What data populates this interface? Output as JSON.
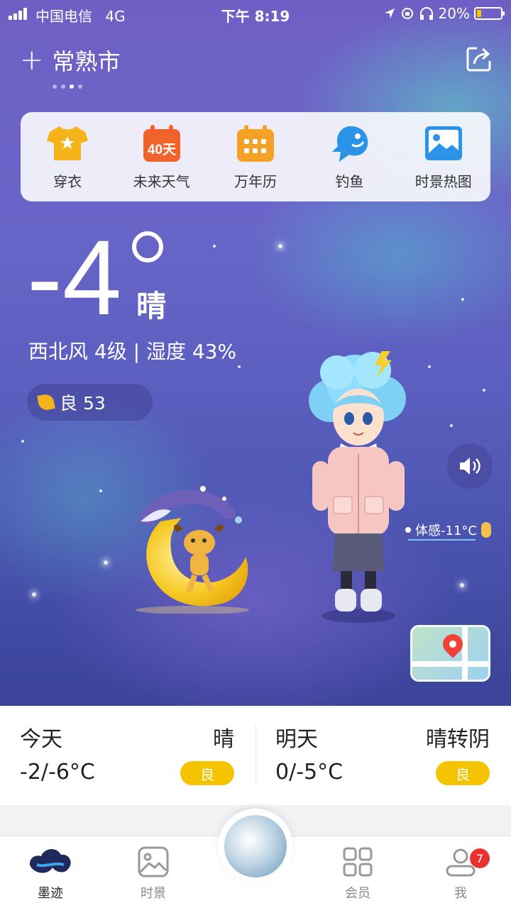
{
  "status_bar": {
    "carrier": "中国电信",
    "network": "4G",
    "time": "下午 8:19",
    "battery_percent": "20%",
    "battery_level": 0.2
  },
  "header": {
    "city": "常熟市",
    "add_icon": "plus-icon",
    "share_icon": "share-icon",
    "page_dots_count": 4,
    "active_page_index": 2
  },
  "shortcuts": [
    {
      "label": "穿衣",
      "icon": "shirt-icon",
      "color": "#f3b319"
    },
    {
      "label": "未来天气",
      "icon": "calendar-40-icon",
      "icon_text": "40天",
      "color": "#f0632a"
    },
    {
      "label": "万年历",
      "icon": "calendar-grid-icon",
      "color": "#f3a226"
    },
    {
      "label": "钓鱼",
      "icon": "fish-icon",
      "color": "#2b93e8"
    },
    {
      "label": "时景热图",
      "icon": "picture-icon",
      "color": "#2b93e8"
    }
  ],
  "current": {
    "temperature": "-4",
    "condition": "晴",
    "wind_humidity": "西北风 4级 | 湿度 43%",
    "aqi_label": "良 53",
    "feels_like": "体感-11°C"
  },
  "forecast": [
    {
      "day": "今天",
      "condition": "晴",
      "range": "-2/-6°C",
      "aqi": "良"
    },
    {
      "day": "明天",
      "condition": "晴转阴",
      "range": "0/-5°C",
      "aqi": "良"
    }
  ],
  "tabs": [
    {
      "label": "墨迹",
      "icon": "moji-cloud-icon",
      "active": true
    },
    {
      "label": "时景",
      "icon": "picture-icon",
      "active": false
    },
    {
      "label": "会员",
      "icon": "grid-icon",
      "active": false
    },
    {
      "label": "我",
      "icon": "profile-icon",
      "active": false
    }
  ],
  "me_badge": "7",
  "colors": {
    "accent_yellow": "#f5c400",
    "badge_red": "#e8322f"
  }
}
